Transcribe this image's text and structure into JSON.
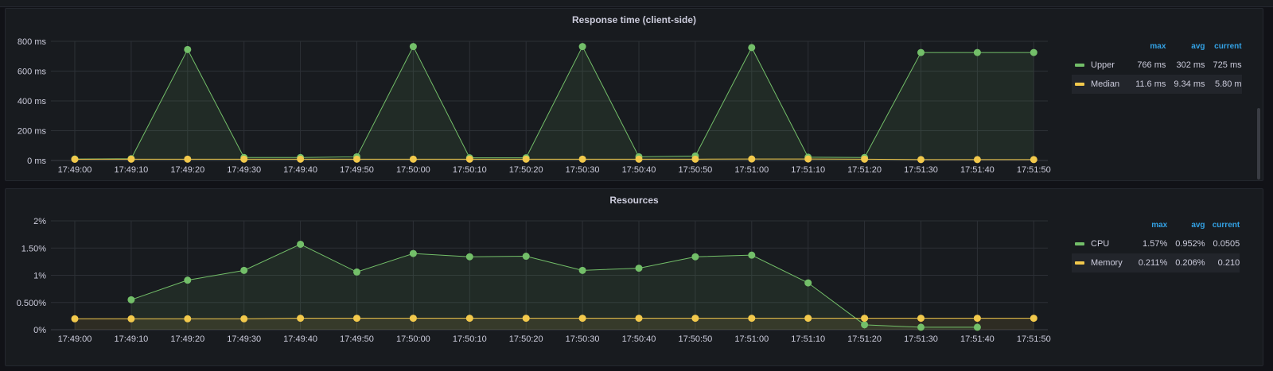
{
  "chart_data": [
    {
      "type": "line",
      "title": "Response time (client-side)",
      "xlabel": "",
      "ylabel": "",
      "categories": [
        "17:49:00",
        "17:49:10",
        "17:49:20",
        "17:49:30",
        "17:49:40",
        "17:49:50",
        "17:50:00",
        "17:50:10",
        "17:50:20",
        "17:50:30",
        "17:50:40",
        "17:50:50",
        "17:51:00",
        "17:51:10",
        "17:51:20",
        "17:51:30",
        "17:51:40",
        "17:51:50"
      ],
      "ylim": [
        0,
        800
      ],
      "yticks": [
        "0 ms",
        "200 ms",
        "400 ms",
        "600 ms",
        "800 ms"
      ],
      "grid": true,
      "legend_placement": "right",
      "legend_columns": [
        "max",
        "avg",
        "current"
      ],
      "series": [
        {
          "name": "Upper",
          "color": "#73bf69",
          "fill": true,
          "values": [
            10,
            12,
            745,
            20,
            20,
            25,
            765,
            18,
            18,
            765,
            25,
            30,
            758,
            22,
            20,
            725,
            725,
            725
          ],
          "stats": [
            "766 ms",
            "302 ms",
            "725 ms"
          ]
        },
        {
          "name": "Median",
          "color": "#f2c94c",
          "fill": false,
          "values": [
            8,
            9,
            9,
            9,
            9,
            9,
            9,
            9,
            9,
            9,
            9,
            9,
            10,
            10,
            9,
            6,
            6,
            6
          ],
          "stats": [
            "11.6 ms",
            "9.34 ms",
            "5.80 m"
          ]
        }
      ]
    },
    {
      "type": "line",
      "title": "Resources",
      "xlabel": "",
      "ylabel": "",
      "categories": [
        "17:49:00",
        "17:49:10",
        "17:49:20",
        "17:49:30",
        "17:49:40",
        "17:49:50",
        "17:50:00",
        "17:50:10",
        "17:50:20",
        "17:50:30",
        "17:50:40",
        "17:50:50",
        "17:51:00",
        "17:51:10",
        "17:51:20",
        "17:51:30",
        "17:51:40",
        "17:51:50"
      ],
      "ylim": [
        0,
        2
      ],
      "yticks": [
        "0%",
        "0.500%",
        "1%",
        "1.50%",
        "2%"
      ],
      "grid": true,
      "legend_placement": "right",
      "legend_columns": [
        "max",
        "avg",
        "current"
      ],
      "series": [
        {
          "name": "CPU",
          "color": "#73bf69",
          "fill": true,
          "values": [
            null,
            0.55,
            0.91,
            1.09,
            1.57,
            1.06,
            1.4,
            1.34,
            1.35,
            1.09,
            1.13,
            1.34,
            1.37,
            0.86,
            0.09,
            0.045,
            0.045,
            null
          ],
          "stats": [
            "1.57%",
            "0.952%",
            "0.0505"
          ]
        },
        {
          "name": "Memory",
          "color": "#f2c94c",
          "fill": true,
          "values": [
            0.2,
            0.2,
            0.2,
            0.2,
            0.21,
            0.21,
            0.21,
            0.21,
            0.21,
            0.21,
            0.21,
            0.21,
            0.21,
            0.21,
            0.21,
            0.21,
            0.21,
            0.21
          ],
          "stats": [
            "0.211%",
            "0.206%",
            "0.210"
          ]
        }
      ]
    }
  ]
}
